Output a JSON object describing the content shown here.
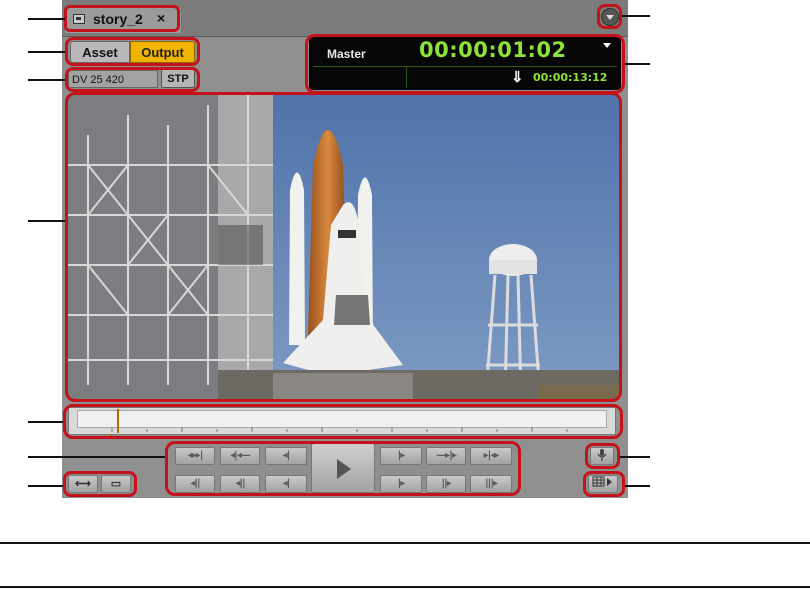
{
  "tab": {
    "title": "story_2",
    "close": "×"
  },
  "mode": {
    "asset": "Asset",
    "output": "Output"
  },
  "format": {
    "label": "DV 25 420",
    "stp": "STP"
  },
  "timecode": {
    "source": "Master",
    "main": "00:00:01:02",
    "sub": "00:00:13:12",
    "sub_icon": "⇓"
  },
  "transport": {
    "top_left": [
      "◂▸▸|",
      "◂|◂—",
      "◂|"
    ],
    "top_right": [
      "|▸",
      "—▸|▸",
      "▸|◂▸"
    ],
    "bottom_left": [
      "◂||",
      "◂||",
      "◂|"
    ],
    "bottom_right": [
      "|▸",
      "||▸",
      "|||▸"
    ]
  },
  "left_buttons": [
    "⟷",
    "▭"
  ],
  "icons": {
    "panel_menu": "chevron-down-icon",
    "audio": "microphone-icon",
    "layout": "grid-icon"
  },
  "colors": {
    "output_active": "#f0b400",
    "timecode_green": "#8de23a",
    "callout_red": "#c4121a"
  },
  "video": {
    "description_colors": [
      "#5d7fb0",
      "#c4762e"
    ]
  }
}
